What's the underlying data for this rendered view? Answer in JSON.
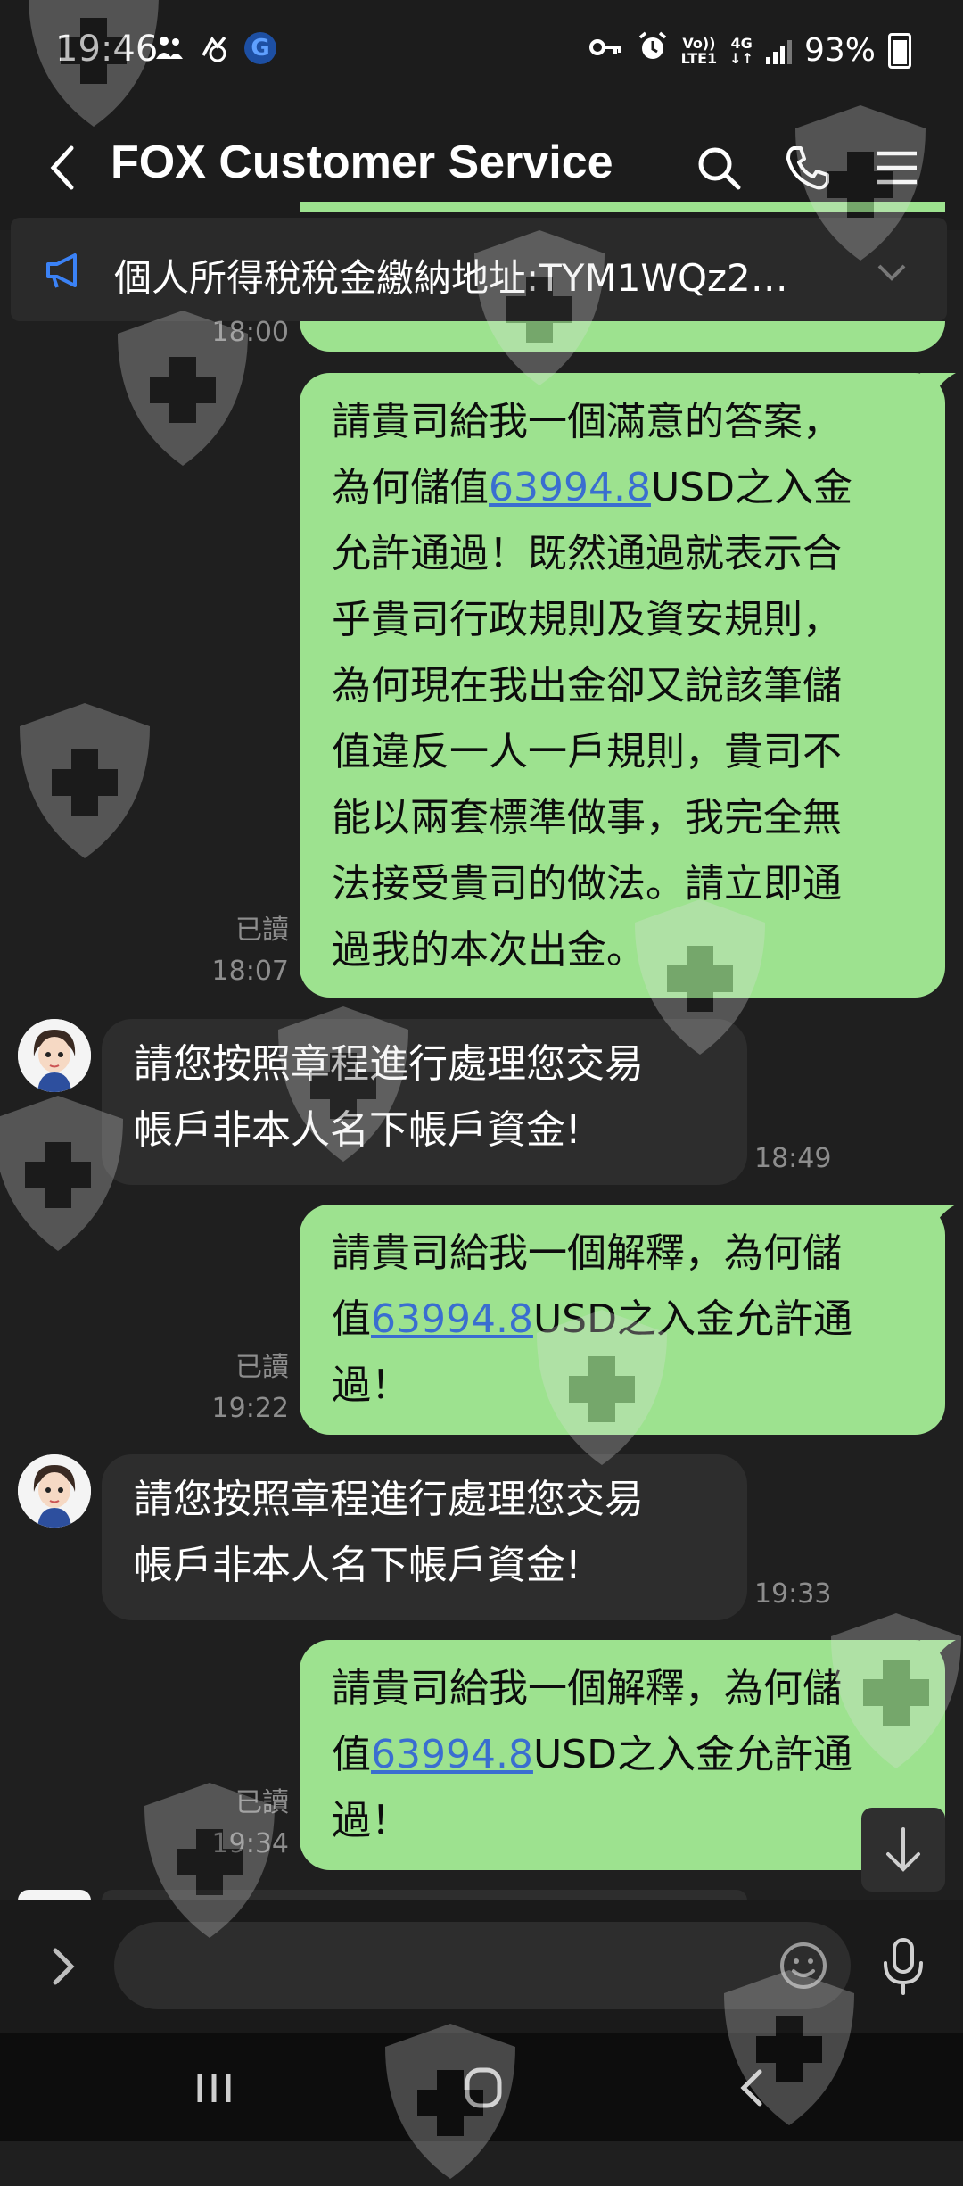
{
  "status_bar": {
    "time": "19:46",
    "network_label_top": "Vo))",
    "network_label_bottom": "LTE1",
    "network_type": "4G",
    "battery": "93%"
  },
  "header": {
    "title": "FOX Customer Service"
  },
  "announcement": {
    "text": "個人所得稅稅金繳納地址:TYM1WQz2…"
  },
  "partial_time": "18:00",
  "messages": [
    {
      "direction": "outgoing",
      "lines": [
        "請貴司給我一個滿意的答案，",
        {
          "before": "為何儲值",
          "link": "63994.8",
          "after": "USD之入金"
        },
        "允許通過！既然通過就表示合",
        "乎貴司行政規則及資安規則，",
        "為何現在我出金卻又說該筆儲",
        "值違反一人一戶規則，貴司不",
        "能以兩套標準做事，我完全無",
        "法接受貴司的做法。請立即通",
        "過我的本次出金。"
      ],
      "read_label": "已讀",
      "time": "18:07"
    },
    {
      "direction": "incoming",
      "lines": [
        "請您按照章程進行處理您交易",
        "帳戶非本人名下帳戶資金!"
      ],
      "time": "18:49"
    },
    {
      "direction": "outgoing",
      "lines": [
        "請貴司給我一個解釋，為何儲",
        {
          "before": "值",
          "link": "63994.8",
          "after": "USD之入金允許通"
        },
        "過！"
      ],
      "read_label": "已讀",
      "time": "19:22"
    },
    {
      "direction": "incoming",
      "lines": [
        "請您按照章程進行處理您交易",
        "帳戶非本人名下帳戶資金!"
      ],
      "time": "19:33"
    },
    {
      "direction": "outgoing",
      "lines": [
        "請貴司給我一個解釋，為何儲",
        {
          "before": "值",
          "link": "63994.8",
          "after": "USD之入金允許通"
        },
        "過！"
      ],
      "read_label": "已讀",
      "time": "19:34"
    }
  ],
  "input": {
    "placeholder": ""
  },
  "colors": {
    "background": "#1f1f1f",
    "outgoing_bubble": "#9de28f",
    "incoming_bubble": "#2d2d2d",
    "link": "#3a6ed0",
    "meta_text": "#8d8d8d"
  },
  "icons": {
    "back": "chevron-left-icon",
    "search": "search-icon",
    "call": "phone-icon",
    "menu": "hamburger-menu-icon",
    "announcement": "megaphone-icon",
    "expand_announcement": "chevron-down-icon",
    "scroll_down": "arrow-down-icon",
    "expand_input": "chevron-right-icon",
    "emoji": "emoji-icon",
    "mic": "microphone-icon",
    "nav_recents": "recents-icon",
    "nav_home": "home-icon",
    "nav_back": "nav-back-icon"
  }
}
